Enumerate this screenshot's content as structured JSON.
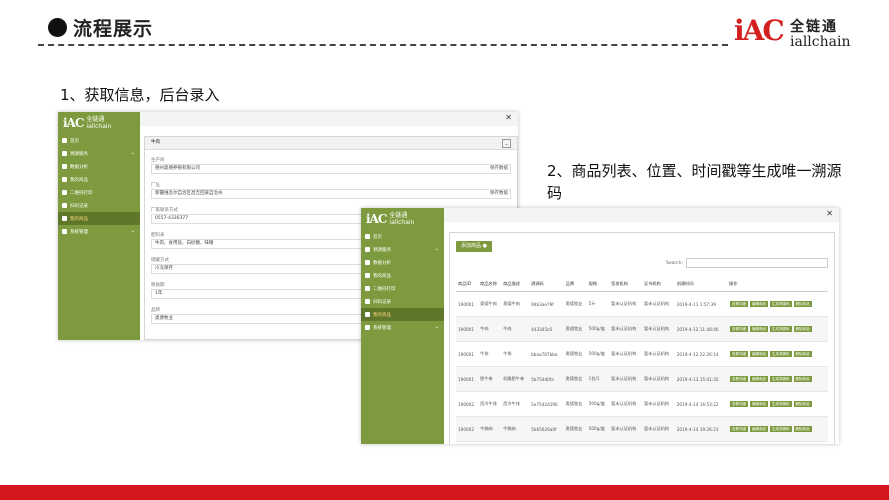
{
  "slide": {
    "title": "流程展示",
    "step1": "1、获取信息，后台录入",
    "step2": "2、商品列表、位置、时间戳等生成唯一溯源码"
  },
  "logo": {
    "mark": "iAC",
    "cn": "全链通",
    "en": "iallchain"
  },
  "colors": {
    "sidebar": "#7d9a3e",
    "accent_red": "#d4171f"
  },
  "shotA": {
    "logo_mark": "iAC",
    "logo_cn": "全链通",
    "logo_en": "iallchain",
    "nav": [
      {
        "label": "首页",
        "active": false
      },
      {
        "label": "溯源服务",
        "active": false,
        "chevron": "⌄"
      },
      {
        "label": "数据分析",
        "active": false
      },
      {
        "label": "我的商品",
        "active": false
      },
      {
        "label": "二维码打印",
        "active": false
      },
      {
        "label": "扫码记录",
        "active": false
      },
      {
        "label": "我的商品",
        "active": true
      },
      {
        "label": "系统管理",
        "active": false,
        "chevron": "⌄"
      }
    ],
    "panel_title": "牛肉",
    "fields": [
      {
        "label": "生产商",
        "value": "德州奥德养殖有限公司",
        "action": "保存数据"
      },
      {
        "label": "厂址",
        "value": "新疆维吾尔自治区昌吉回族自治州",
        "action": "保存数据"
      },
      {
        "label": "厂家联系方式",
        "value": "0557-4336377",
        "action": ""
      },
      {
        "label": "配料表",
        "value": "牛肉、食用盐、白砂糖、味精",
        "action": ""
      },
      {
        "label": "储藏方式",
        "value": "冷冻保存",
        "action": ""
      },
      {
        "label": "保质期",
        "value": "1年",
        "action": ""
      },
      {
        "label": "品牌",
        "value": "奥德牧业",
        "action": "保存数据"
      }
    ]
  },
  "shotB": {
    "logo_mark": "iAC",
    "logo_cn": "全链通",
    "logo_en": "iallchain",
    "add_button": "添加商品",
    "search_label": "Search:",
    "nav": [
      {
        "label": "首页",
        "active": false
      },
      {
        "label": "溯源服务",
        "active": false,
        "chevron": "⌄"
      },
      {
        "label": "数据分析",
        "active": false
      },
      {
        "label": "我的商品",
        "active": false
      },
      {
        "label": "二维码打印",
        "active": false
      },
      {
        "label": "扫码记录",
        "active": false
      },
      {
        "label": "我的商品",
        "active": true
      },
      {
        "label": "系统管理",
        "active": false,
        "chevron": "⌄"
      }
    ],
    "columns": [
      "商品ID",
      "商品名称",
      "商品描述",
      "溯源码",
      "品牌",
      "规格",
      "签发机构",
      "证书机构",
      "创建时间",
      "操作"
    ],
    "rows": [
      [
        "190001",
        "奥德牛肉",
        "奥德牛肉",
        "9db3ae79f",
        "奥德牧业",
        "5斤",
        "暂未认证机构",
        "暂未认证机构",
        "2019-4-11 1:57:39"
      ],
      [
        "190001",
        "牛肉",
        "牛肉",
        "443345e5",
        "奥德牧业",
        "500g/盒",
        "暂未认证机构",
        "暂未认证机构",
        "2019-4-12 11:48:46"
      ],
      [
        "190001",
        "牛排",
        "牛排",
        "bbaa787bba",
        "奥德牧业",
        "500g/盒",
        "暂未认证机构",
        "暂未认证机构",
        "2019-4-12 22:26:14"
      ],
      [
        "190001",
        "肥牛卷",
        "奶酪肥牛卷",
        "5b75dd0fa",
        "奥德牧业",
        "1包/1",
        "暂未认证机构",
        "暂未认证机构",
        "2019-4-13 15:01:35"
      ],
      [
        "190002",
        "西冷牛排",
        "西冷牛排",
        "5e7542d190",
        "奥德牧业",
        "500g/盒",
        "暂未认证机构",
        "暂未认证机构",
        "2019-4-14 16:53:22"
      ],
      [
        "190002",
        "牛腩肉",
        "牛腩肉",
        "5b65626a0f",
        "奥德牧业",
        "500g/盒",
        "暂未认证机构",
        "暂未认证机构",
        "2019-4-14 19:26:23"
      ],
      [
        "190002",
        "眼肉上脑",
        "眼肉上脑",
        "efa3390f9",
        "奥德牧业",
        "500g/盒",
        "暂未认证机构",
        "暂未认证机构",
        "2019-4-15"
      ]
    ],
    "row_actions": [
      "查看详细",
      "编辑商品",
      "生成溯源码",
      "删除商品"
    ]
  }
}
